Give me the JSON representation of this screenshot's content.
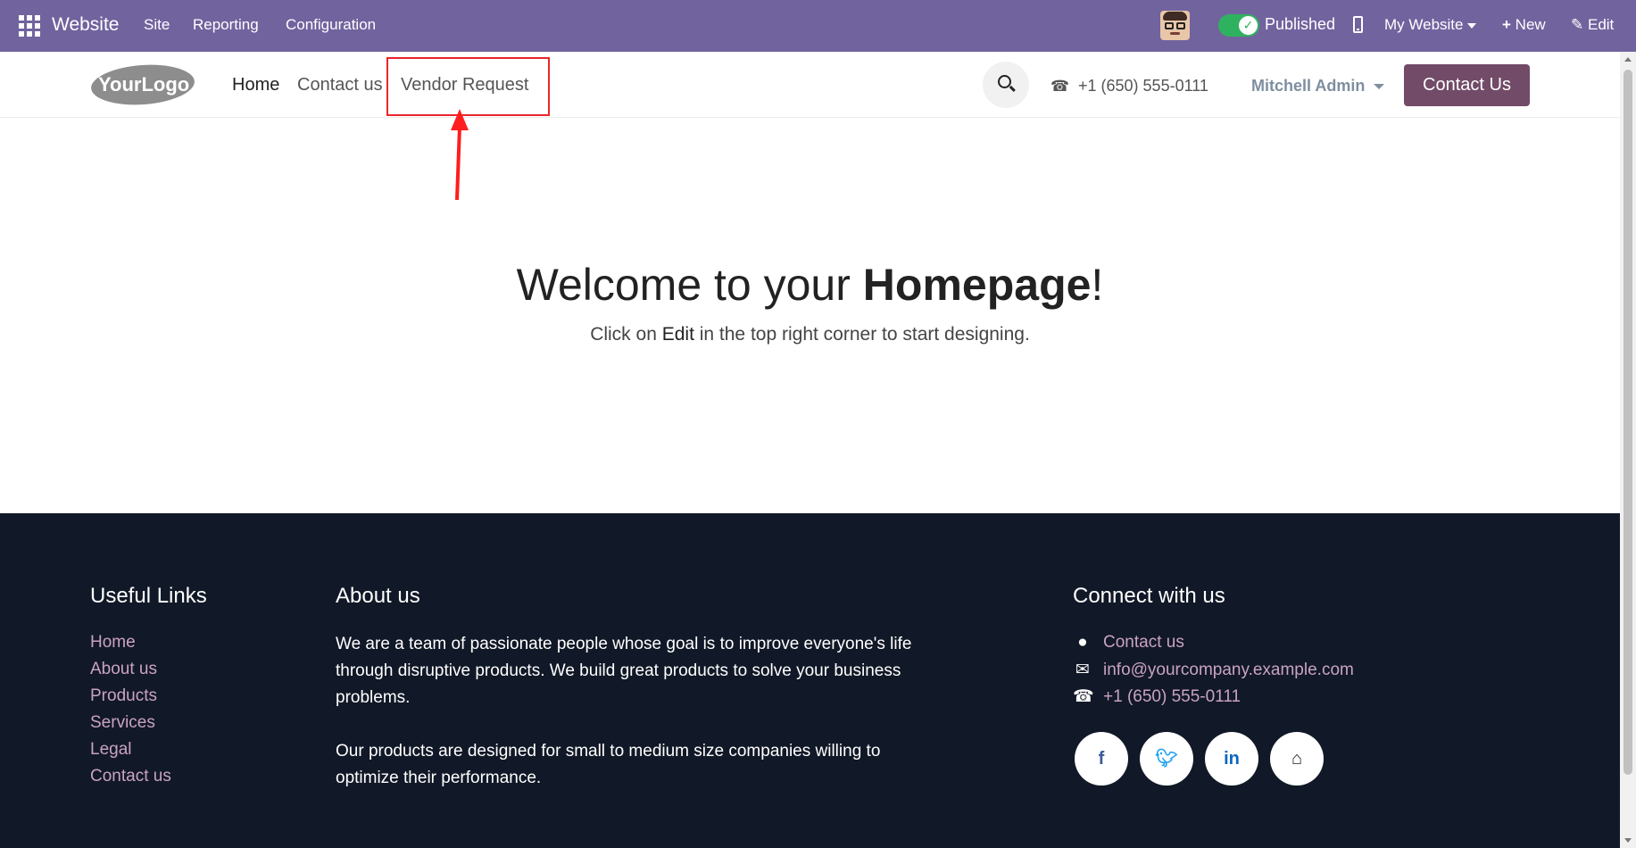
{
  "adminbar": {
    "brand": "Website",
    "menus": [
      "Site",
      "Reporting",
      "Configuration"
    ],
    "published_label": "Published",
    "website_selector": "My Website",
    "new_label": "New",
    "edit_label": "Edit",
    "accent": "#71639e"
  },
  "header": {
    "logo_text": "YourLogo",
    "nav": [
      "Home",
      "Contact us",
      "Vendor Request"
    ],
    "phone": "+1 (650) 555-0111",
    "user": "Mitchell Admin",
    "cta_label": "Contact Us",
    "cta_color": "#714b67"
  },
  "hero": {
    "title_prefix": "Welcome to your ",
    "title_bold": "Homepage",
    "title_suffix": "!",
    "sub_prefix": "Click on ",
    "sub_bold": "Edit",
    "sub_suffix": " in the top right corner to start designing."
  },
  "footer": {
    "useful_links_title": "Useful Links",
    "useful_links": [
      "Home",
      "About us",
      "Products",
      "Services",
      "Legal",
      "Contact us"
    ],
    "about_title": "About us",
    "about_p1": "We are a team of passionate people whose goal is to improve everyone's life through disruptive products. We build great products to solve your business problems.",
    "about_p2": "Our products are designed for small to medium size companies willing to optimize their performance.",
    "connect_title": "Connect with us",
    "contact_link": "Contact us",
    "email": "info@yourcompany.example.com",
    "phone": "+1 (650) 555-0111",
    "social_icons": [
      "facebook-icon",
      "twitter-icon",
      "linkedin-icon",
      "home-icon"
    ]
  }
}
